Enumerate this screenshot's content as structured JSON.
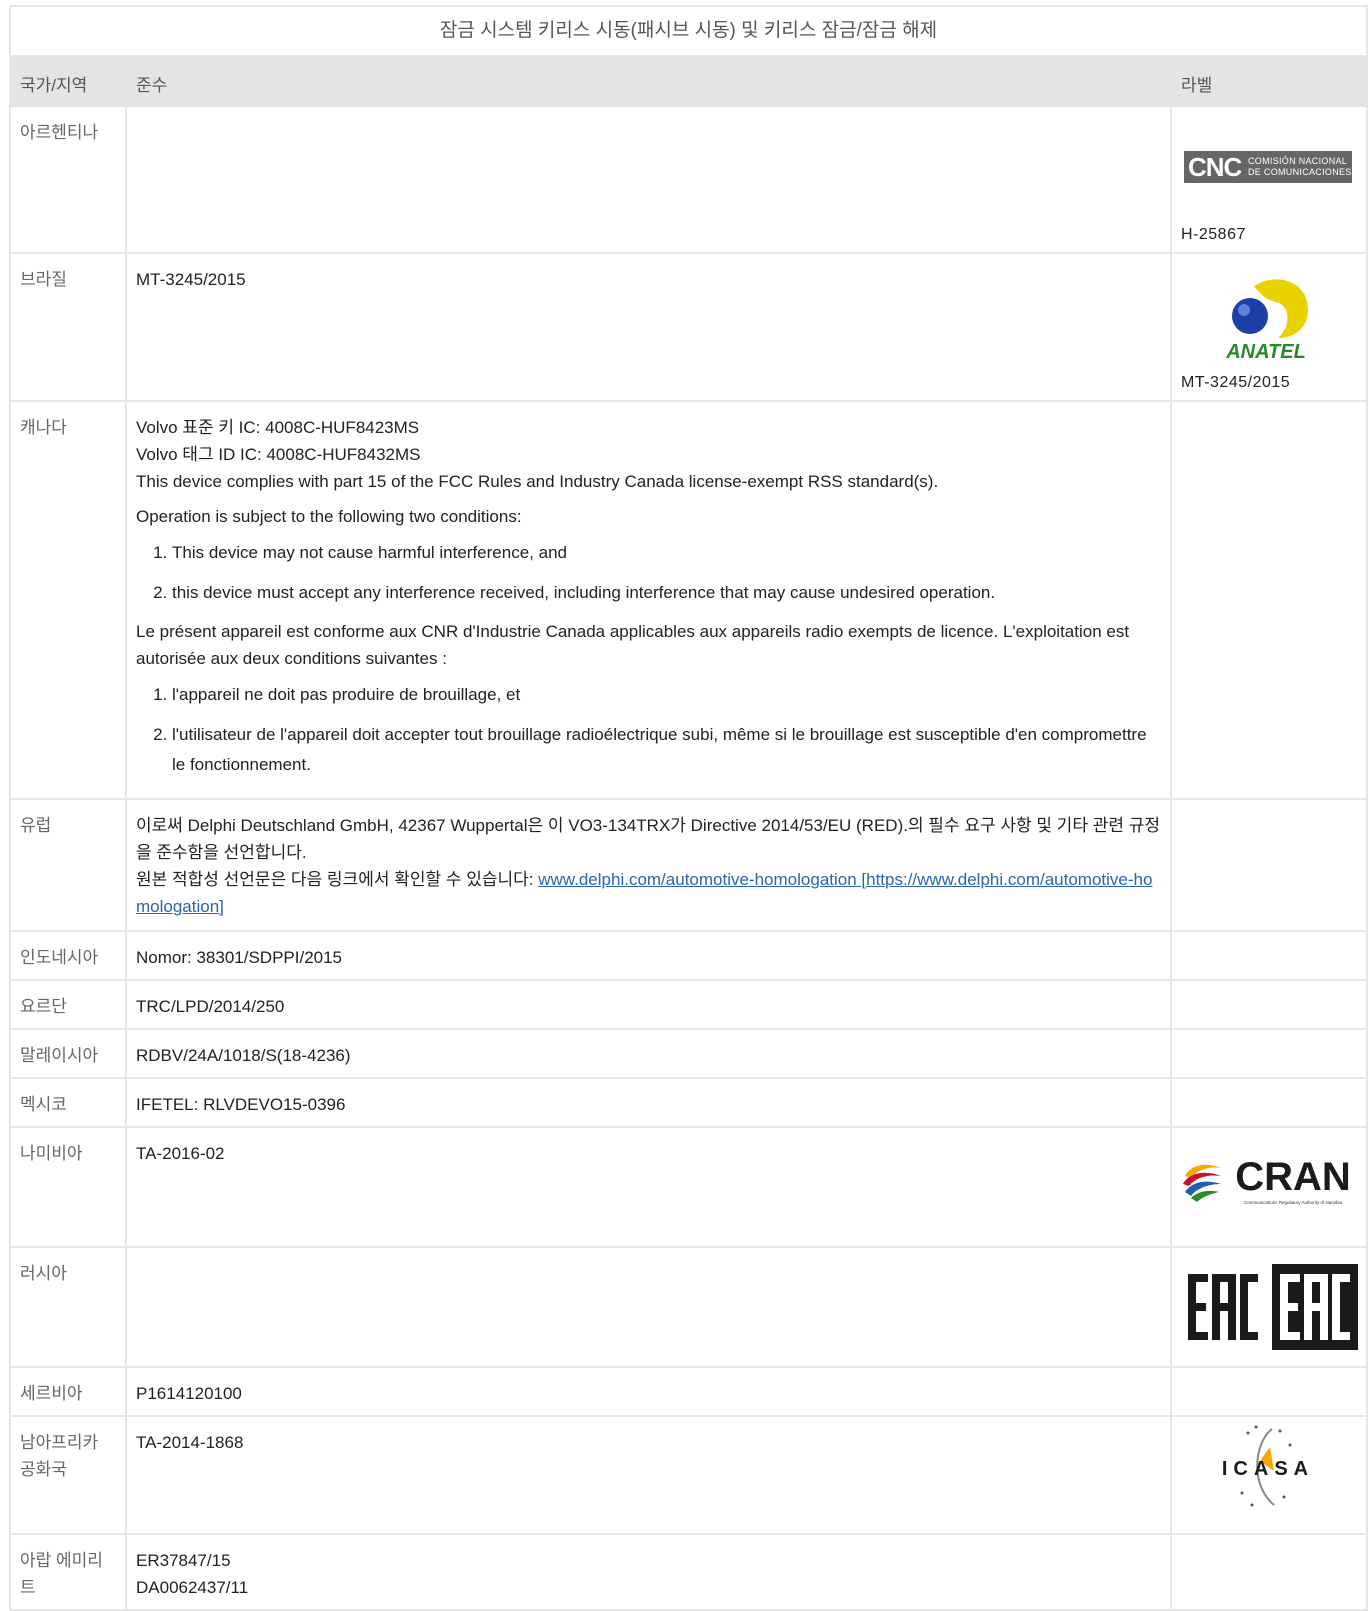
{
  "table": {
    "caption": "잠금 시스템 키리스 시동(패시브 시동) 및 키리스 잠금/잠금 해제",
    "headers": {
      "country": "국가/지역",
      "compliance": "준수",
      "label": "라벨"
    }
  },
  "rows": {
    "argentina": {
      "country": "아르헨티나",
      "label_code": "H-25867",
      "logo": {
        "main": "CNC",
        "line1": "COMISIÓN NACIONAL",
        "line2": "DE COMUNICACIONES",
        "color": "#666666"
      }
    },
    "brazil": {
      "country": "브라질",
      "compliance": "MT-3245/2015",
      "label_code": "MT-3245/2015",
      "logo": {
        "text": "ANATEL",
        "colors": {
          "yellow": "#e8d200",
          "blue": "#1b3ea8",
          "green": "#2a8a2a"
        }
      }
    },
    "canada": {
      "country": "캐나다",
      "line1": "Volvo 표준 키 IC: 4008C-HUF8423MS",
      "line2": "Volvo 태그 ID IC: 4008C-HUF8432MS",
      "line3": "This device complies with part 15 of the FCC Rules and Industry Canada license-exempt RSS standard(s).",
      "line4": "Operation is subject to the following two conditions:",
      "en_items": [
        "This device may not cause harmful interference, and",
        "this device must accept any interference received, including interference that may cause undesired operation."
      ],
      "fr_para": "Le présent appareil est conforme aux CNR d'Industrie Canada applicables aux appareils radio exempts de licence. L'exploitation est autorisée aux deux conditions suivantes :",
      "fr_items": [
        "l'appareil ne doit pas produire de brouillage, et",
        "l'utilisateur de l'appareil doit accepter tout brouillage radioélectrique subi, même si le brouillage est susceptible d'en compromettre le fonctionnement."
      ]
    },
    "europe": {
      "country": "유럽",
      "line1": "이로써 Delphi Deutschland GmbH, 42367 Wuppertal은 이 VO3-134TRX가 Directive 2014/53/EU (RED).의 필수 요구 사항 및 기타 관련 규정을 준수함을 선언합니다.",
      "line2_prefix": "원본 적합성 선언문은 다음 링크에서 확인할 수 있습니다: ",
      "link_text": "www.delphi.com/automotive-homologation [https://www.delphi.com/automotive-homologation]",
      "link_color": "#2a64b2"
    },
    "indonesia": {
      "country": "인도네시아",
      "compliance": "Nomor: 38301/SDPPI/2015"
    },
    "jordan": {
      "country": "요르단",
      "compliance": "TRC/LPD/2014/250"
    },
    "malaysia": {
      "country": "말레이시아",
      "compliance": "RDBV/24A/1018/S(18-4236)"
    },
    "mexico": {
      "country": "멕시코",
      "compliance": "IFETEL: RLVDEVO15-0396"
    },
    "namibia": {
      "country": "나미비아",
      "compliance": "TA-2016-02",
      "logo": {
        "text": "CRAN",
        "subtitle": "Communications Regulatory Authority of Namibia"
      }
    },
    "russia": {
      "country": "러시아",
      "logo": {
        "text": "EAC"
      }
    },
    "serbia": {
      "country": "세르비아",
      "compliance": "P1614120100"
    },
    "south_africa": {
      "country": "남아프리카 공화국",
      "compliance": "TA-2014-1868",
      "logo": {
        "text": "ICASA"
      }
    },
    "uae": {
      "country": "아랍 에미리트",
      "line1": "ER37847/15",
      "line2": "DA0062437/11"
    }
  }
}
